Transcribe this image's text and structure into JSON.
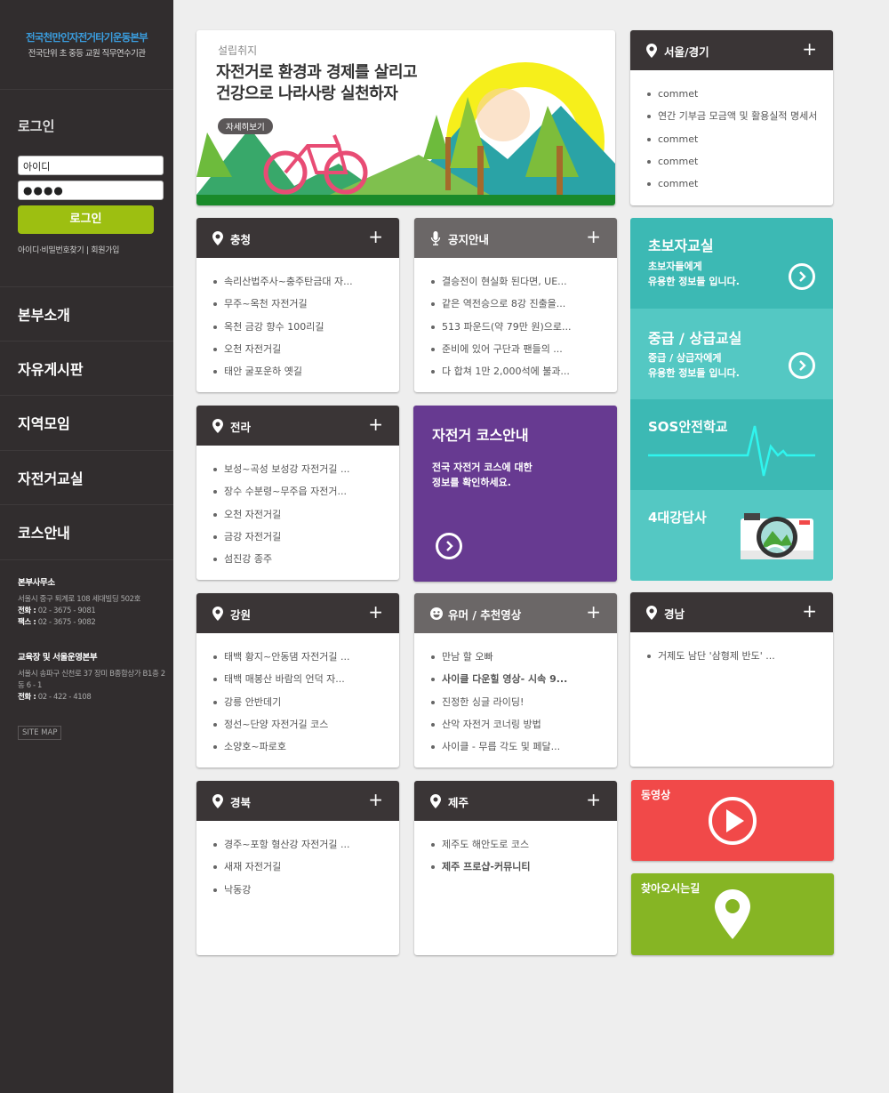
{
  "sidebar": {
    "logo_line1": "전국천만인자전거타기운동본부",
    "logo_line2": "전국단위 초 중등 교원 직무연수기관",
    "login_title": "로그인",
    "id_value": "아이디",
    "pw_value": "●●●●",
    "login_button": "로그인",
    "login_links": "아이디·비밀번호찾기 | 회원가입",
    "nav": [
      "본부소개",
      "자유게시판",
      "지역모임",
      "자전거교실",
      "코스안내"
    ],
    "office1": {
      "title": "본부사무소",
      "addr": "서울시 중구 퇴계로 108 세대빌딩 502호",
      "tel_label": "전화 :",
      "tel": " 02 - 3675 - 9081",
      "fax_label": "팩스 :",
      "fax": " 02 - 3675 - 9082"
    },
    "office2": {
      "title": "교육장 및 서울운영본부",
      "addr": "서울시 송파구 신천로 37 장미 B종합상가 B1층 2동 6 - 1",
      "tel_label": "전화 :",
      "tel": " 02 - 422 - 4108"
    },
    "sitemap": "SITE MAP"
  },
  "hero": {
    "sub": "설립취지",
    "line1": "자전거로 환경과 경제를 살리고",
    "line2": "건강으로 나라사랑 실천하자",
    "more": "자세히보기"
  },
  "cards": {
    "seoul": {
      "title": "서울/경기",
      "items": [
        "commet",
        "연간 기부금 모금액 및 활용실적 명세서",
        "commet",
        "commet",
        "commet"
      ]
    },
    "chungcheong": {
      "title": "충청",
      "items": [
        "속리산법주사~충주탄금대 자...",
        "무주~옥천 자전거길",
        "옥천 금강 향수 100리길",
        "오천 자전거길",
        "태안 굴포운하 옛길"
      ]
    },
    "notice": {
      "title": "공지안내",
      "items": [
        "결승전이 현실화 된다면, UE...",
        "같은 역전승으로 8강 진출을...",
        "513 파운드(약 79만 원)으로...",
        "준비에 있어 구단과 팬들의 ...",
        "다 합쳐 1만 2,000석에 불과..."
      ]
    },
    "jeolla": {
      "title": "전라",
      "items": [
        "보성~곡성 보성강 자전거길 ...",
        "장수 수분령~무주읍 자전거...",
        "오천 자전거길",
        "금강 자전거길",
        "섬진강 종주"
      ]
    },
    "gangwon": {
      "title": "강원",
      "items": [
        "태백 황지~안동댐 자전거길 ...",
        "태백 매봉산 바람의 언덕 자...",
        "강릉 안반데기",
        "정선~단양 자전거길 코스",
        "소양호~파로호"
      ]
    },
    "humor": {
      "title": "유머 / 추천영상",
      "items": [
        "만남 할 오빠",
        "사이클 다운힐 영상- 시속 9...",
        "진정한 싱글 라이딩!",
        "산악 자전거 코너링 방법",
        "사이클 - 무릅 각도 및 페달..."
      ]
    },
    "gyeongnam": {
      "title": "경남",
      "items": [
        "거제도 남단 '삼형제 반도' ..."
      ]
    },
    "gyeongbuk": {
      "title": "경북",
      "items": [
        "경주~포항 형산강 자전거길 ...",
        "새재 자전거길",
        "낙동강"
      ]
    },
    "jeju": {
      "title": "제주",
      "items": [
        "제주도 해안도로 코스",
        "제주 프로샵-커뮤니티"
      ]
    }
  },
  "tiles": {
    "course": {
      "title": "자전거 코스안내",
      "desc1": "전국 자전거 코스에 대한",
      "desc2": "정보를 확인하세요."
    },
    "beginner": {
      "title": "초보자교실",
      "desc1": "초보자들에게",
      "desc2": "유용한 정보들 입니다."
    },
    "advanced": {
      "title": "중급 / 상급교실",
      "desc1": "중급 / 상급자에게",
      "desc2": "유용한 정보들 입니다."
    },
    "sos": {
      "title": "SOS안전학교"
    },
    "river": {
      "title": "4대강답사"
    },
    "video": {
      "title": "동영상"
    },
    "location": {
      "title": "찾아오시는길"
    }
  },
  "colors": {
    "sidebar": "#312d2e",
    "accent_green": "#9dbf11",
    "teal": "#3cb9b4",
    "teal_light": "#54c8c3",
    "purple": "#673a91",
    "red": "#f14949",
    "green": "#86b524"
  }
}
